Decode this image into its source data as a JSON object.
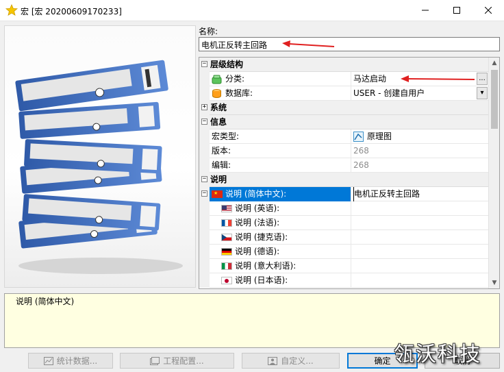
{
  "window": {
    "title": "宏 [宏 20200609170233]"
  },
  "name_field": {
    "label": "名称:",
    "value": "电机正反转主回路"
  },
  "grid": {
    "rows": [
      {
        "type": "category",
        "label": "层级结构",
        "expanded": true
      },
      {
        "type": "property",
        "name": "分类:",
        "value": "马达启动",
        "icon": "category-icon",
        "button": "..."
      },
      {
        "type": "property",
        "name": "数据库:",
        "value": "USER - 创建自用户",
        "icon": "database-icon",
        "button": "▾"
      },
      {
        "type": "category",
        "label": "系统",
        "expanded": false
      },
      {
        "type": "category",
        "label": "信息",
        "expanded": true
      },
      {
        "type": "property",
        "name": "宏类型:",
        "value": "原理图",
        "icon": "schematic-icon"
      },
      {
        "type": "property",
        "name": "版本:",
        "value": "268",
        "readonly": true
      },
      {
        "type": "property",
        "name": "编辑:",
        "value": "268",
        "readonly": true
      },
      {
        "type": "category",
        "label": "说明",
        "expanded": true
      },
      {
        "type": "property",
        "name": "说明 (简体中文):",
        "value": "电机正反转主回路",
        "flag": "cn-flag-icon",
        "selected": true
      },
      {
        "type": "property",
        "name": "说明 (英语):",
        "value": "",
        "flag": "us-flag-icon"
      },
      {
        "type": "property",
        "name": "说明 (法语):",
        "value": "",
        "flag": "fr-flag-icon"
      },
      {
        "type": "property",
        "name": "说明 (捷克语):",
        "value": "",
        "flag": "cz-flag-icon"
      },
      {
        "type": "property",
        "name": "说明 (德语):",
        "value": "",
        "flag": "de-flag-icon"
      },
      {
        "type": "property",
        "name": "说明 (意大利语):",
        "value": "",
        "flag": "it-flag-icon"
      },
      {
        "type": "property",
        "name": "说明 (日本语):",
        "value": "",
        "flag": "jp-flag-icon"
      }
    ]
  },
  "description_panel": {
    "text": "说明 (简体中文)"
  },
  "buttons": {
    "stats": "统计数据...",
    "project_config": "工程配置...",
    "custom": "自定义...",
    "ok": "确定",
    "cancel": "取消"
  },
  "watermark": "瓴沃科技",
  "colors": {
    "selection": "#0078d7",
    "tooltip_bg": "#ffffe1",
    "annotation_arrow": "#e02020",
    "binder_blue": "#4a78c2"
  }
}
